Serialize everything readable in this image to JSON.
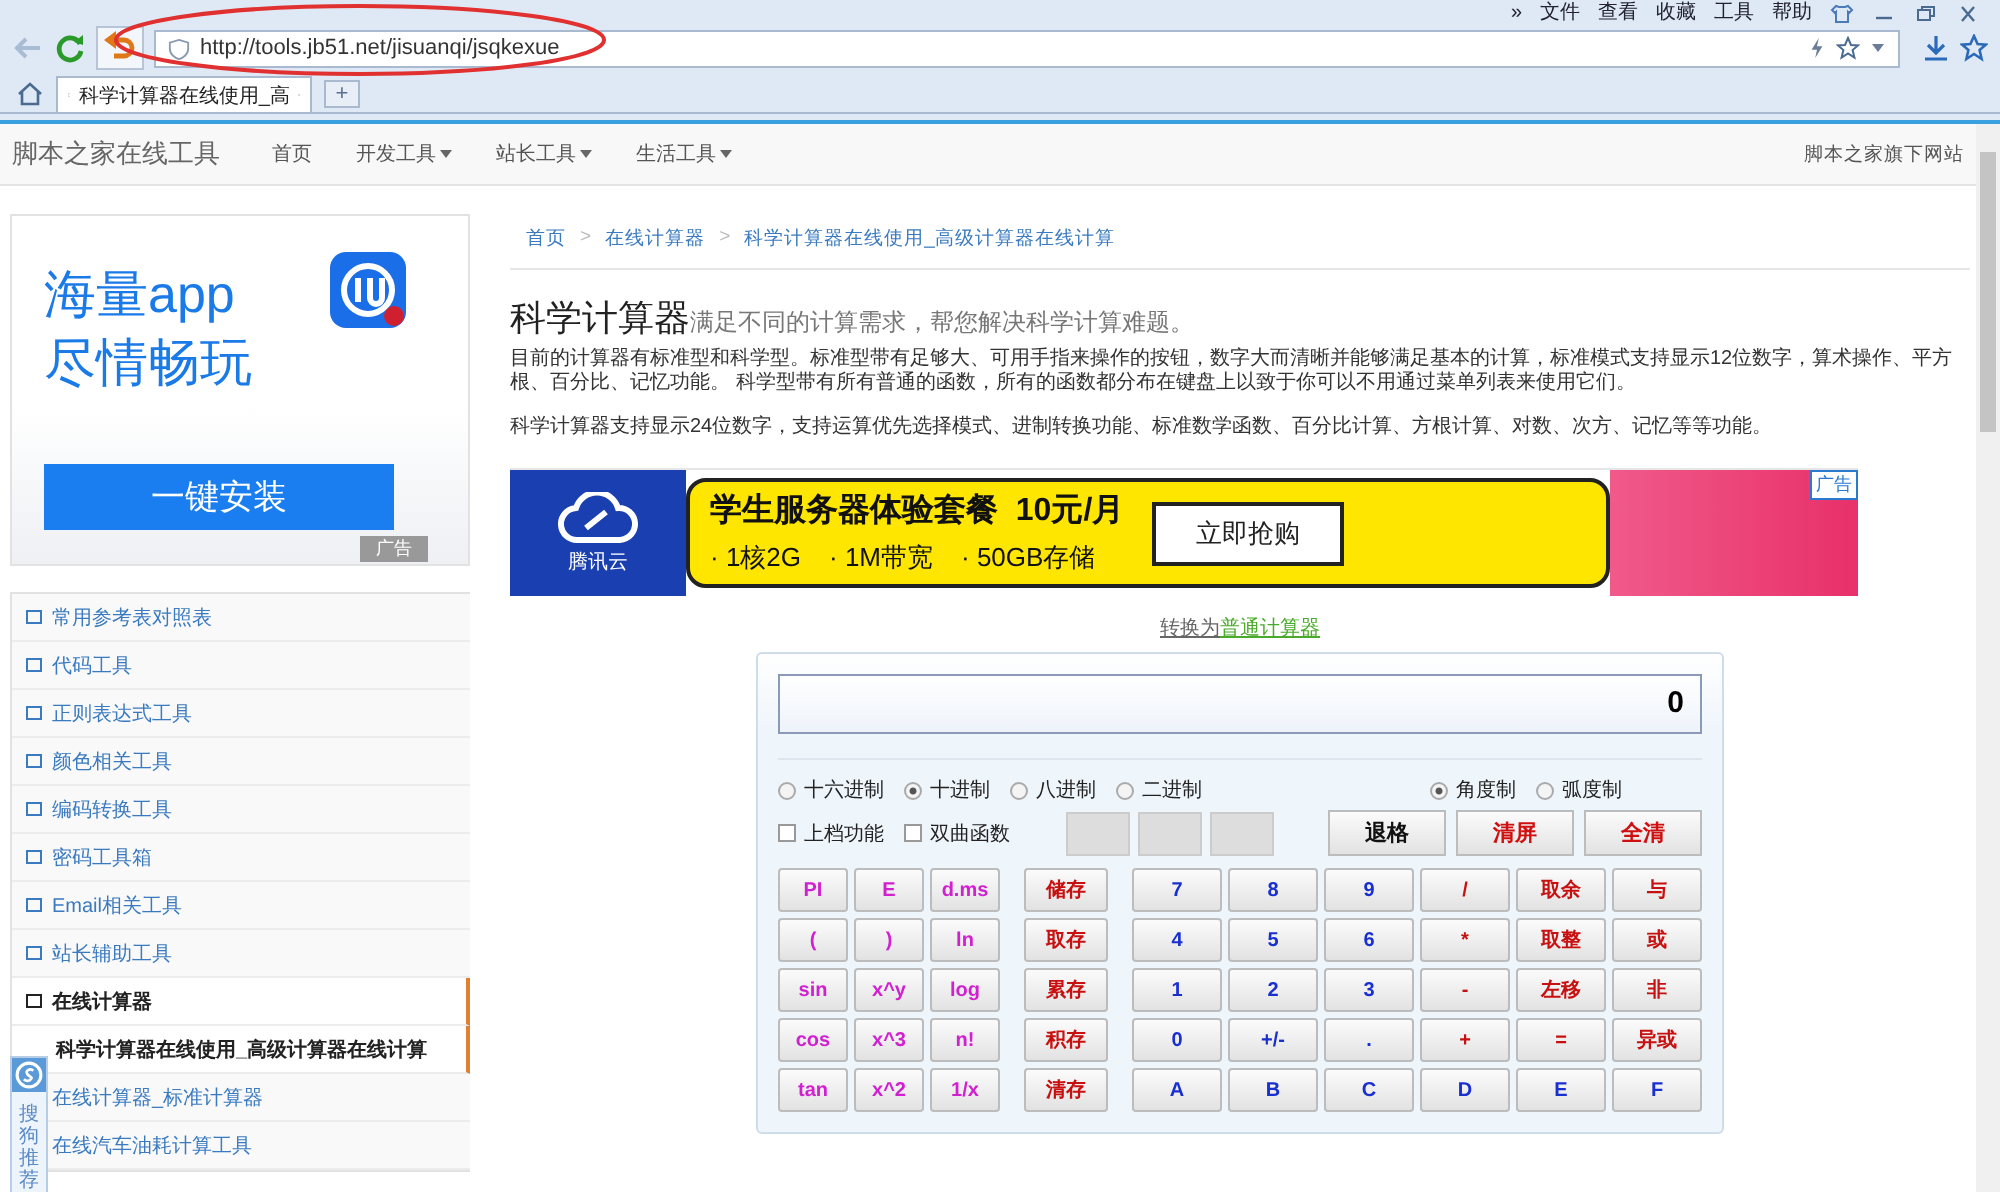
{
  "browser": {
    "menu": [
      "»",
      "文件",
      "查看",
      "收藏",
      "工具",
      "帮助"
    ],
    "url": "http://tools.jb51.net/jisuanqi/jsqkexue",
    "tab_title": "科学计算器在线使用_高",
    "new_tab": "+"
  },
  "header": {
    "logo": "脚本之家在线工具",
    "nav": [
      {
        "label": "首页",
        "dropdown": false
      },
      {
        "label": "开发工具",
        "dropdown": true
      },
      {
        "label": "站长工具",
        "dropdown": true
      },
      {
        "label": "生活工具",
        "dropdown": true
      }
    ],
    "right": "脚本之家旗下网站"
  },
  "sidebar": {
    "ad": {
      "line1": "海量app",
      "line2": "尽情畅玩",
      "button": "一键安装",
      "tag": "广告"
    },
    "items": [
      {
        "label": "常用参考表对照表",
        "selected": false
      },
      {
        "label": "代码工具",
        "selected": false
      },
      {
        "label": "正则表达式工具",
        "selected": false
      },
      {
        "label": "颜色相关工具",
        "selected": false
      },
      {
        "label": "编码转换工具",
        "selected": false
      },
      {
        "label": "密码工具箱",
        "selected": false
      },
      {
        "label": "Email相关工具",
        "selected": false
      },
      {
        "label": "站长辅助工具",
        "selected": false
      },
      {
        "label": "在线计算器",
        "selected": true,
        "children": [
          {
            "label": "科学计算器在线使用_高级计算器在线计算",
            "selected": true
          },
          {
            "label": "在线计算器_标准计算器",
            "selected": false
          },
          {
            "label": "在线汽车油耗计算工具",
            "selected": false
          }
        ]
      }
    ]
  },
  "float_panel": {
    "text": "搜狗推荐"
  },
  "breadcrumb": {
    "separator": ">",
    "items": [
      "首页",
      "在线计算器",
      "科学计算器在线使用_高级计算器在线计算"
    ]
  },
  "title": "科学计算器",
  "subtitle": "满足不同的计算需求，帮您解决科学计算难题。",
  "paragraphs": [
    "目前的计算器有标准型和科学型。标准型带有足够大、可用手指来操作的按钮，数字大而清晰并能够满足基本的计算，标准模式支持显示12位数字，算术操作、平方根、百分比、记忆功能。 科学型带有所有普通的函数，所有的函数都分布在键盘上以致于你可以不用通过菜单列表来使用它们。",
    "科学计算器支持显示24位数字，支持运算优先选择模式、进制转换功能、标准数学函数、百分比计算、方根计算、对数、次方、记忆等等功能。"
  ],
  "banner": {
    "brand": "腾讯云",
    "headline": "学生服务器体验套餐  10元/月",
    "features": [
      "· 1核2G",
      "· 1M带宽",
      "· 50GB存储"
    ],
    "button": "立即抢购",
    "tag": "广告"
  },
  "switch": {
    "prefix": "转换为",
    "link": "普通计算器"
  },
  "calculator": {
    "display": "0",
    "bases": [
      {
        "label": "十六进制",
        "selected": false
      },
      {
        "label": "十进制",
        "selected": true
      },
      {
        "label": "八进制",
        "selected": false
      },
      {
        "label": "二进制",
        "selected": false
      }
    ],
    "angles": [
      {
        "label": "角度制",
        "selected": true
      },
      {
        "label": "弧度制",
        "selected": false
      }
    ],
    "options": [
      {
        "label": "上档功能",
        "checked": false
      },
      {
        "label": "双曲函数",
        "checked": false
      }
    ],
    "actions": [
      {
        "label": "退格",
        "kind": "plain"
      },
      {
        "label": "清屏",
        "kind": "alert"
      },
      {
        "label": "全清",
        "kind": "alert"
      }
    ],
    "function_keys": [
      {
        "label": "PI",
        "kind": "fn"
      },
      {
        "label": "E",
        "kind": "fn"
      },
      {
        "label": "d.ms",
        "kind": "fn"
      },
      {
        "label": "(",
        "kind": "fn"
      },
      {
        "label": ")",
        "kind": "fn"
      },
      {
        "label": "ln",
        "kind": "fn"
      },
      {
        "label": "sin",
        "kind": "fn"
      },
      {
        "label": "x^y",
        "kind": "fn"
      },
      {
        "label": "log",
        "kind": "fn"
      },
      {
        "label": "cos",
        "kind": "fn"
      },
      {
        "label": "x^3",
        "kind": "fn"
      },
      {
        "label": "n!",
        "kind": "fn"
      },
      {
        "label": "tan",
        "kind": "fn"
      },
      {
        "label": "x^2",
        "kind": "fn"
      },
      {
        "label": "1/x",
        "kind": "fn"
      }
    ],
    "memory_keys": [
      {
        "label": "储存",
        "kind": "op"
      },
      {
        "label": "取存",
        "kind": "op"
      },
      {
        "label": "累存",
        "kind": "op"
      },
      {
        "label": "积存",
        "kind": "op"
      },
      {
        "label": "清存",
        "kind": "op"
      }
    ],
    "main_keys": [
      {
        "label": "7",
        "kind": "num"
      },
      {
        "label": "8",
        "kind": "num"
      },
      {
        "label": "9",
        "kind": "num"
      },
      {
        "label": "/",
        "kind": "op"
      },
      {
        "label": "取余",
        "kind": "op"
      },
      {
        "label": "与",
        "kind": "op"
      },
      {
        "label": "4",
        "kind": "num"
      },
      {
        "label": "5",
        "kind": "num"
      },
      {
        "label": "6",
        "kind": "num"
      },
      {
        "label": "*",
        "kind": "op"
      },
      {
        "label": "取整",
        "kind": "op"
      },
      {
        "label": "或",
        "kind": "op"
      },
      {
        "label": "1",
        "kind": "num"
      },
      {
        "label": "2",
        "kind": "num"
      },
      {
        "label": "3",
        "kind": "num"
      },
      {
        "label": "-",
        "kind": "op"
      },
      {
        "label": "左移",
        "kind": "op"
      },
      {
        "label": "非",
        "kind": "op"
      },
      {
        "label": "0",
        "kind": "num"
      },
      {
        "label": "+/-",
        "kind": "num"
      },
      {
        "label": ".",
        "kind": "num"
      },
      {
        "label": "+",
        "kind": "op"
      },
      {
        "label": "=",
        "kind": "op"
      },
      {
        "label": "异或",
        "kind": "op"
      },
      {
        "label": "A",
        "kind": "num"
      },
      {
        "label": "B",
        "kind": "num"
      },
      {
        "label": "C",
        "kind": "num"
      },
      {
        "label": "D",
        "kind": "num"
      },
      {
        "label": "E",
        "kind": "num"
      },
      {
        "label": "F",
        "kind": "num"
      }
    ]
  }
}
